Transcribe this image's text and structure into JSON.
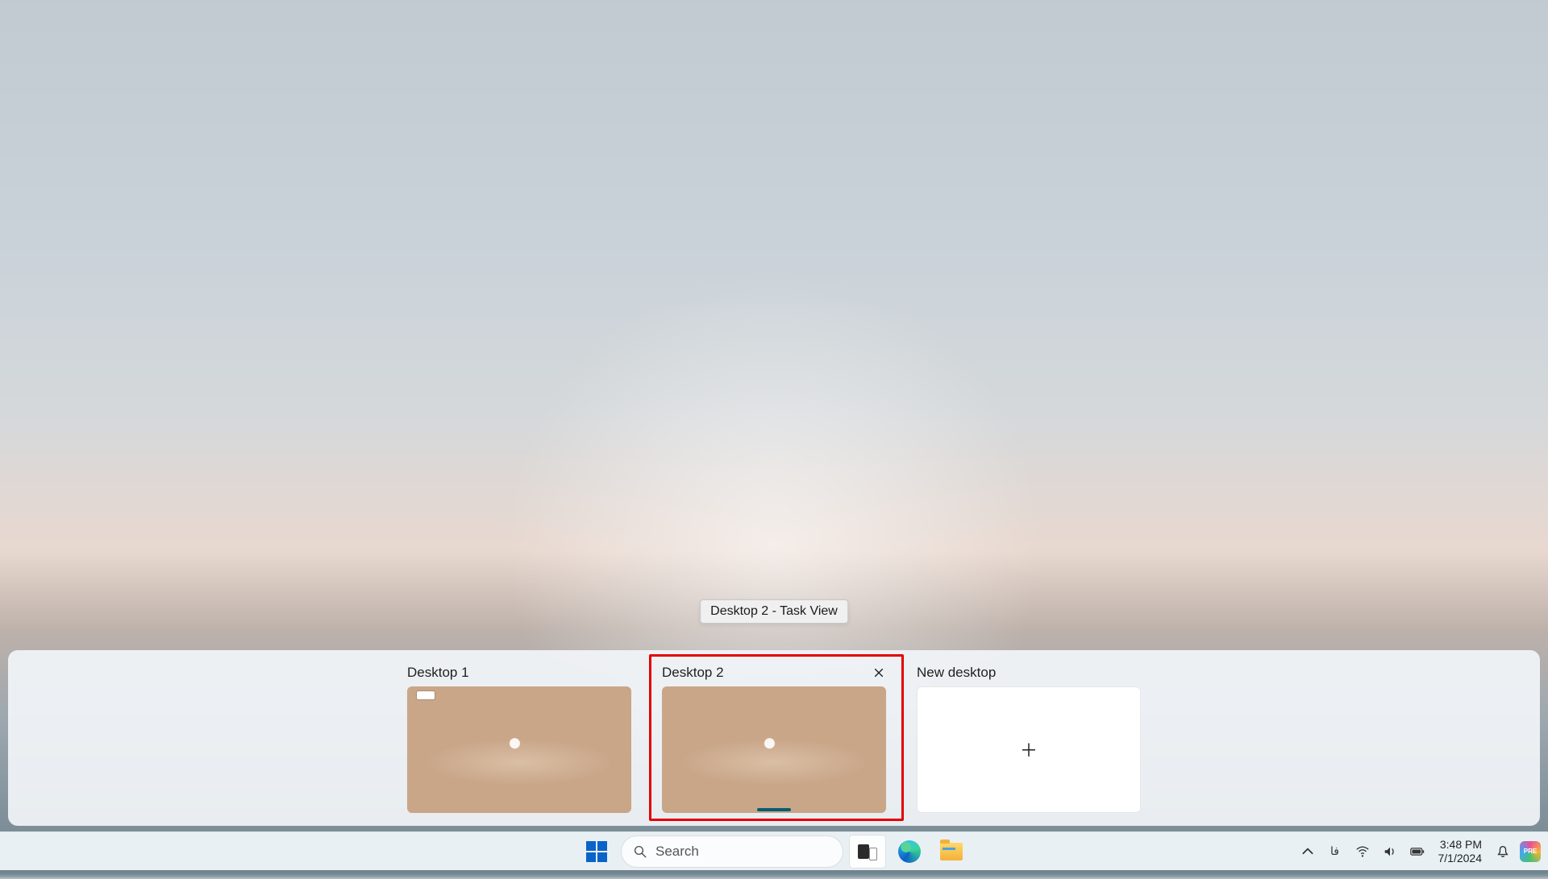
{
  "tooltip": "Desktop 2 - Task View",
  "desktops": [
    {
      "label": "Desktop 1"
    },
    {
      "label": "Desktop 2"
    }
  ],
  "new_desktop_label": "New desktop",
  "taskbar": {
    "search_placeholder": "Search",
    "language": "فا",
    "time": "3:48 PM",
    "date": "7/1/2024",
    "pre_badge": "PRE"
  }
}
